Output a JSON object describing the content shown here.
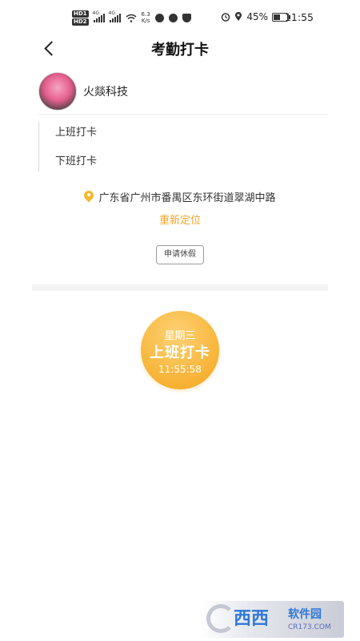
{
  "status_bar": {
    "network_speed": "6.3\nK/s",
    "battery": "45%",
    "time": "11:55"
  },
  "header": {
    "title": "考勤打卡"
  },
  "company": {
    "name": "火燚科技"
  },
  "punch": {
    "clock_in_label": "上班打卡",
    "clock_out_label": "下班打卡"
  },
  "location": {
    "address": "广东省广州市番禺区东环街道翠湖中路",
    "relocate": "重新定位"
  },
  "leave_button": "申请休假",
  "clock_button": {
    "weekday": "星期三",
    "label": "上班打卡",
    "time": "11:55:58"
  },
  "watermark": {
    "brand": "西西",
    "brand2": "软件园",
    "url": "CR173.COM"
  },
  "colors": {
    "accent": "#f7b335",
    "relocate": "#f2a524"
  }
}
